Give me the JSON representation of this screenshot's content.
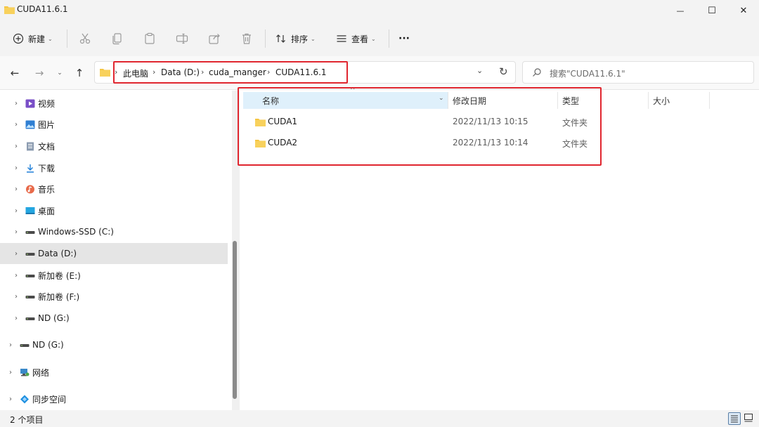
{
  "window": {
    "title": "CUDA11.6.1",
    "controls": {
      "minimize": "—",
      "maximize": "☐",
      "close": "✕"
    }
  },
  "toolbar": {
    "new_label": "新建",
    "sort_label": "排序",
    "view_label": "查看",
    "more": "···"
  },
  "address": {
    "crumbs": [
      "此电脑",
      "Data (D:)",
      "cuda_manger",
      "CUDA11.6.1"
    ],
    "search_placeholder": "搜索\"CUDA11.6.1\""
  },
  "nav": {
    "items": [
      {
        "label": "视频",
        "icon": "video-icon"
      },
      {
        "label": "图片",
        "icon": "picture-icon"
      },
      {
        "label": "文档",
        "icon": "document-icon"
      },
      {
        "label": "下载",
        "icon": "download-icon"
      },
      {
        "label": "音乐",
        "icon": "music-icon"
      },
      {
        "label": "桌面",
        "icon": "desktop-icon"
      },
      {
        "label": "Windows-SSD (C:)",
        "icon": "drive-icon"
      },
      {
        "label": "Data (D:)",
        "icon": "drive-icon",
        "selected": true
      },
      {
        "label": "新加卷 (E:)",
        "icon": "drive-icon"
      },
      {
        "label": "新加卷 (F:)",
        "icon": "drive-icon"
      },
      {
        "label": "ND (G:)",
        "icon": "drive-icon"
      },
      {
        "label": "ND (G:)",
        "icon": "drive-icon"
      },
      {
        "label": "网络",
        "icon": "network-icon"
      },
      {
        "label": "同步空间",
        "icon": "sync-space-icon"
      }
    ]
  },
  "list": {
    "columns": {
      "name": "名称",
      "modified": "修改日期",
      "type": "类型",
      "size": "大小"
    },
    "rows": [
      {
        "name": "CUDA1",
        "modified": "2022/11/13 10:15",
        "type": "文件夹"
      },
      {
        "name": "CUDA2",
        "modified": "2022/11/13 10:14",
        "type": "文件夹"
      }
    ]
  },
  "status": {
    "item_count": "2 个项目"
  },
  "colors": {
    "annotation": "#e0262f",
    "folder": "#f5c542",
    "selected_header": "#dff0fb"
  }
}
